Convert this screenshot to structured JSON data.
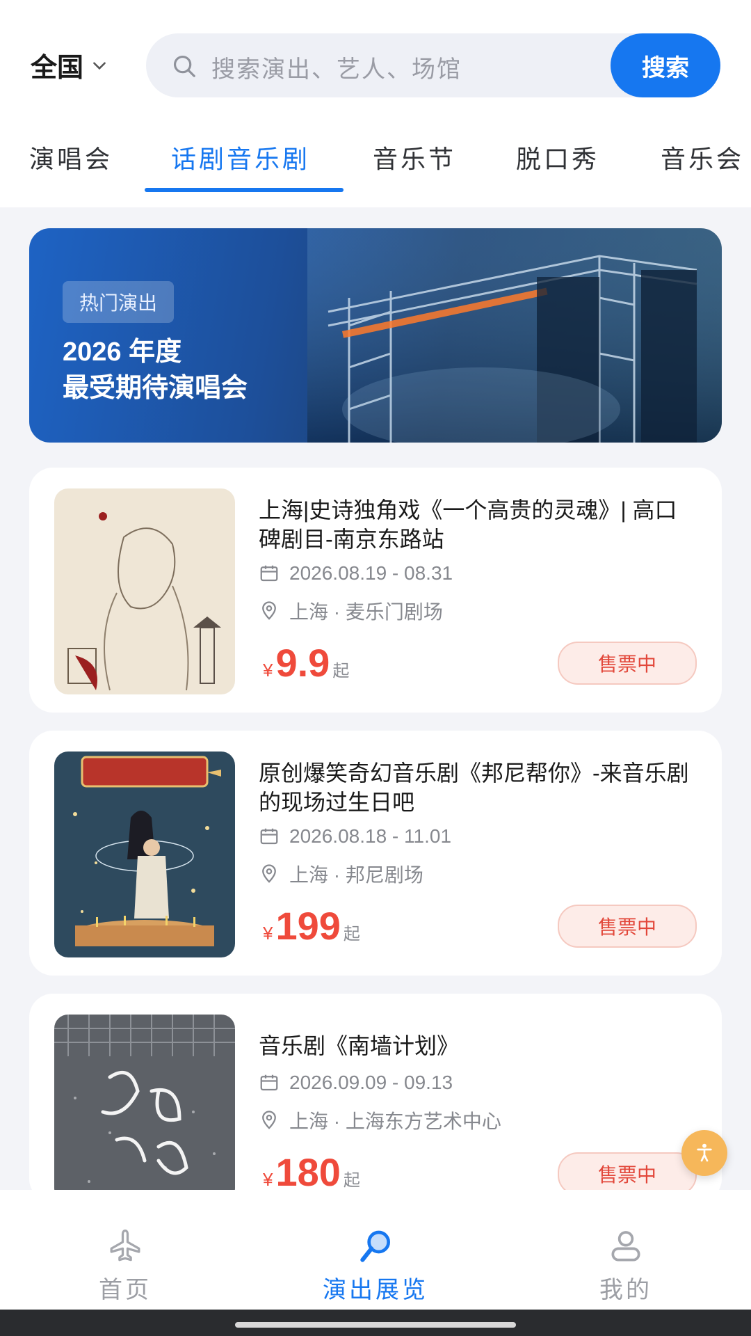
{
  "header": {
    "city": "全国",
    "search_placeholder": "搜索演出、艺人、场馆",
    "search_button": "搜索"
  },
  "tabs": [
    "演唱会",
    "话剧音乐剧",
    "音乐节",
    "脱口秀",
    "音乐会"
  ],
  "active_tab_index": 1,
  "banner": {
    "tag": "热门演出",
    "title_line1": "2026 年度",
    "title_line2": "最受期待演唱会"
  },
  "events": [
    {
      "title": "上海|史诗独角戏《一个高贵的灵魂》| 高口碑剧目-南京东路站",
      "date": "2026.08.19 - 08.31",
      "location": "上海 · 麦乐门剧场",
      "price_symbol": "¥",
      "price": "9.9",
      "price_suffix": "起",
      "status": "售票中"
    },
    {
      "title": "原创爆笑奇幻音乐剧《邦尼帮你》-来音乐剧的现场过生日吧",
      "date": "2026.08.18 - 11.01",
      "location": "上海 · 邦尼剧场",
      "price_symbol": "¥",
      "price": "199",
      "price_suffix": "起",
      "status": "售票中"
    },
    {
      "title": "音乐剧《南墙计划》",
      "date": "2026.09.09 - 09.13",
      "location": "上海 · 上海东方艺术中心",
      "price_symbol": "¥",
      "price": "180",
      "price_suffix": "起",
      "status": "售票中"
    }
  ],
  "bottom_nav": [
    {
      "label": "首页",
      "icon": "airplane-icon"
    },
    {
      "label": "演出展览",
      "icon": "microphone-icon"
    },
    {
      "label": "我的",
      "icon": "person-icon"
    }
  ],
  "active_nav_index": 1,
  "colors": {
    "accent": "#1677f0",
    "price": "#ef4a3b",
    "status_bg": "#fdece8"
  }
}
